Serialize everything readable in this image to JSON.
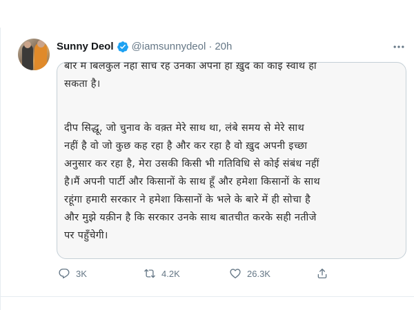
{
  "tweet": {
    "author_name": "Sunny Deol",
    "handle": "@iamsunnydeol",
    "separator": "·",
    "time": "20h",
    "verified": true,
    "accent_color": "#1da1f2"
  },
  "letter": {
    "lines": [
      "बार मे बिलकुल नहीं सोच रहे उनको अपना ही ख़ुद का कोई स्वार्थ हो",
      "सकता है।",
      "दीप सिद्धू, जो चुनाव के वक़्त मेरे साथ था, लंबे समय से मेरे साथ",
      "नहीं है वो जो कुछ कह रहा है और कर रहा है वो ख़ुद अपनी इच्छा",
      "अनुसार कर रहा है, मेरा उसकी किसी भी गतिविधि से कोई संबंध नहीं",
      "है।मैं अपनी पार्टी और  किसानों के साथ हूँ और हमेशा किसानों के साथ",
      "रहूंगा हमारी सरकार ने हमेशा किसानों के भले के बारे में ही सोचा है",
      "और मुझे यक़ीन है कि सरकार उनके साथ बातचीत करके सही नतीजे",
      "पर पहुँचेगी।"
    ]
  },
  "actions": {
    "reply_count": "3K",
    "retweet_count": "4.2K",
    "like_count": "26.3K",
    "icons": [
      "reply-icon",
      "retweet-icon",
      "like-icon",
      "share-icon"
    ]
  }
}
